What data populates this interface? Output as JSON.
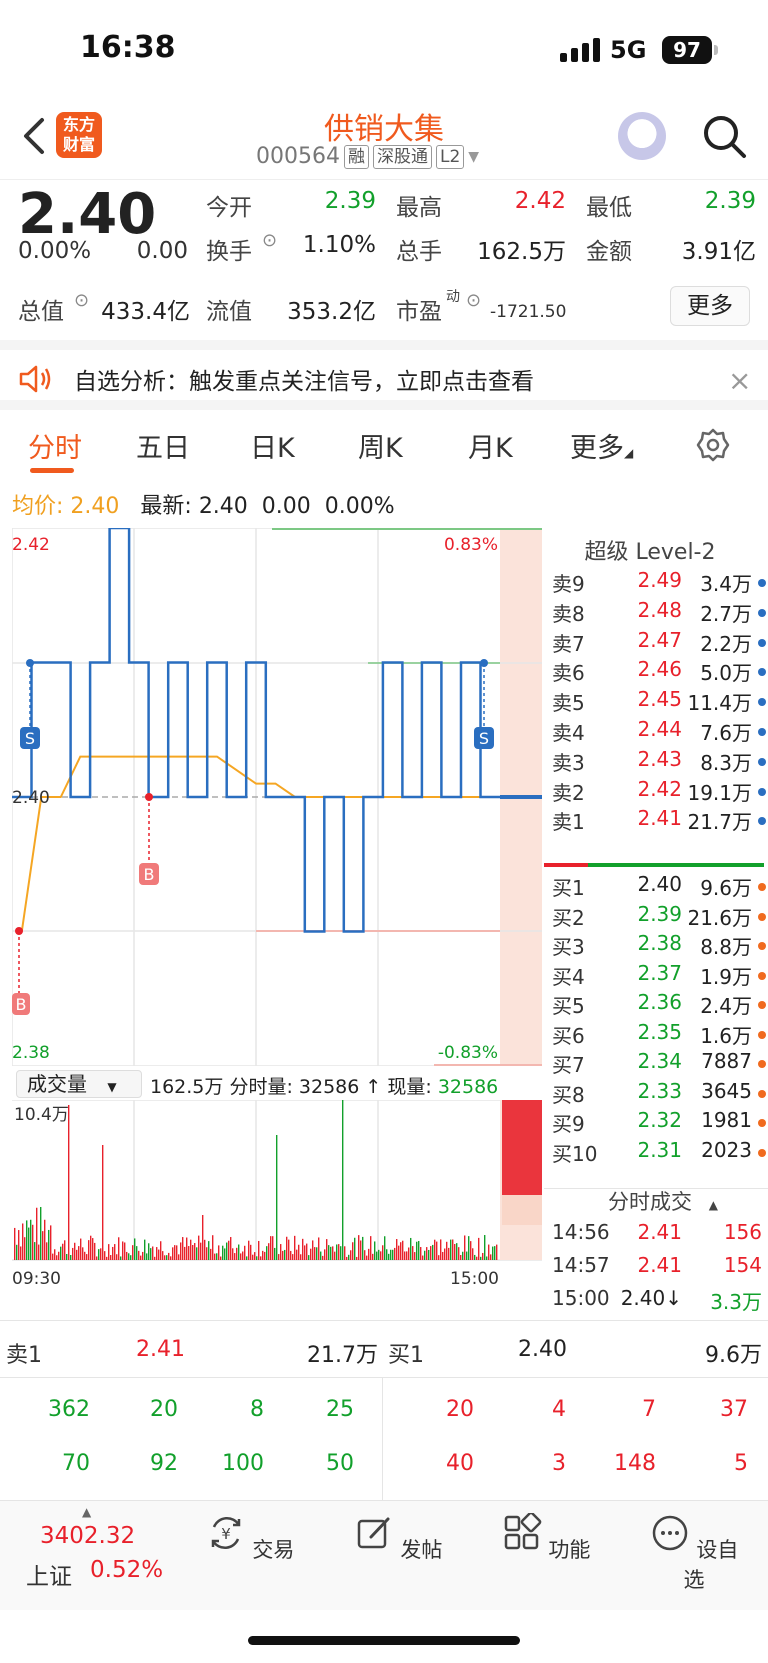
{
  "status": {
    "time": "16:38",
    "network": "5G",
    "battery": "97"
  },
  "header": {
    "logo": "东方财富",
    "stock_name": "供销大集",
    "code": "000564",
    "tags": [
      "融",
      "深股通",
      "L2"
    ]
  },
  "quote": {
    "price": "2.40",
    "change_pct": "0.00%",
    "change": "0.00",
    "open_label": "今开",
    "open": "2.39",
    "high_label": "最高",
    "high": "2.42",
    "low_label": "最低",
    "low": "2.39",
    "turnover_label": "换手",
    "turnover": "1.10%",
    "volume_label": "总手",
    "volume": "162.5万",
    "amount_label": "金额",
    "amount": "3.91亿",
    "mktcap_label": "总值",
    "mktcap": "433.4亿",
    "float_label": "流值",
    "float": "353.2亿",
    "pe_label": "市盈",
    "pe_sup": "动",
    "pe": "-1721.50",
    "more": "更多"
  },
  "banner": {
    "text": "自选分析：触发重点关注信号，立即点击查看"
  },
  "tabs": [
    "分时",
    "五日",
    "日K",
    "周K",
    "月K",
    "更多"
  ],
  "infobar": {
    "avg_label": "均价:",
    "avg": "2.40",
    "latest_label": "最新:",
    "latest": "2.40",
    "chg": "0.00",
    "pct": "0.00%"
  },
  "chart": {
    "ymax": "2.42",
    "ymin": "2.38",
    "pct_max": "0.83%",
    "pct_min": "-0.83%",
    "mid": "2.40",
    "t_start": "09:30",
    "t_end": "15:00",
    "vol_max": "10.4万",
    "markers": {
      "s": "S",
      "b": "B"
    }
  },
  "chart_data": {
    "type": "line",
    "y_range": [
      2.38,
      2.42
    ],
    "series": [
      {
        "name": "最新",
        "values": [
          2.4,
          2.41,
          2.41,
          2.4,
          2.41,
          2.42,
          2.41,
          2.4,
          2.41,
          2.4,
          2.41,
          2.4,
          2.41,
          2.4,
          2.4,
          2.39,
          2.4,
          2.39,
          2.4,
          2.41,
          2.4,
          2.41,
          2.4,
          2.41,
          2.4
        ]
      },
      {
        "name": "均价",
        "values": [
          2.39,
          2.4,
          2.4,
          2.403,
          2.403,
          2.403,
          2.403,
          2.403,
          2.403,
          2.403,
          2.403,
          2.402,
          2.401,
          2.401,
          2.4,
          2.4,
          2.4,
          2.4,
          2.4,
          2.4,
          2.4,
          2.4,
          2.4,
          2.4,
          2.4
        ]
      }
    ]
  },
  "book": {
    "title": "超级 Level-2",
    "asks": [
      {
        "label": "卖9",
        "price": "2.49",
        "vol": "3.4万"
      },
      {
        "label": "卖8",
        "price": "2.48",
        "vol": "2.7万"
      },
      {
        "label": "卖7",
        "price": "2.47",
        "vol": "2.2万"
      },
      {
        "label": "卖6",
        "price": "2.46",
        "vol": "5.0万"
      },
      {
        "label": "卖5",
        "price": "2.45",
        "vol": "11.4万"
      },
      {
        "label": "卖4",
        "price": "2.44",
        "vol": "7.6万"
      },
      {
        "label": "卖3",
        "price": "2.43",
        "vol": "8.3万"
      },
      {
        "label": "卖2",
        "price": "2.42",
        "vol": "19.1万"
      },
      {
        "label": "卖1",
        "price": "2.41",
        "vol": "21.7万"
      }
    ],
    "bids": [
      {
        "label": "买1",
        "price": "2.40",
        "vol": "9.6万"
      },
      {
        "label": "买2",
        "price": "2.39",
        "vol": "21.6万"
      },
      {
        "label": "买3",
        "price": "2.38",
        "vol": "8.8万"
      },
      {
        "label": "买4",
        "price": "2.37",
        "vol": "1.9万"
      },
      {
        "label": "买5",
        "price": "2.36",
        "vol": "2.4万"
      },
      {
        "label": "买6",
        "price": "2.35",
        "vol": "1.6万"
      },
      {
        "label": "买7",
        "price": "2.34",
        "vol": "7887"
      },
      {
        "label": "买8",
        "price": "2.33",
        "vol": "3645"
      },
      {
        "label": "买9",
        "price": "2.32",
        "vol": "1981"
      },
      {
        "label": "买10",
        "price": "2.31",
        "vol": "2023"
      }
    ],
    "ticks_title": "分时成交",
    "ticks": [
      {
        "time": "14:56",
        "price": "2.41",
        "vol": "156"
      },
      {
        "time": "14:57",
        "price": "2.41",
        "vol": "154"
      },
      {
        "time": "15:00",
        "price": "2.40↓",
        "vol": "3.3万"
      }
    ]
  },
  "volume": {
    "select": "成交量",
    "total": "162.5万",
    "label": "分时量:",
    "value": "32586 ↑",
    "now_label": "现量:",
    "now": "32586"
  },
  "bottom": {
    "ask_label": "卖1",
    "ask_price": "2.41",
    "ask_vol": "21.7万",
    "bid_label": "买1",
    "bid_price": "2.40",
    "bid_vol": "9.6万",
    "left_row1": [
      "362",
      "20",
      "8",
      "25"
    ],
    "left_row2": [
      "70",
      "92",
      "100",
      "50"
    ],
    "right_row1": [
      "20",
      "4",
      "7",
      "37"
    ],
    "right_row2": [
      "40",
      "3",
      "148",
      "5"
    ]
  },
  "nav": {
    "index_value": "3402.32",
    "index_name": "上证",
    "index_pct": "0.52%",
    "items": [
      "交易",
      "发帖",
      "功能",
      "设自选"
    ]
  }
}
